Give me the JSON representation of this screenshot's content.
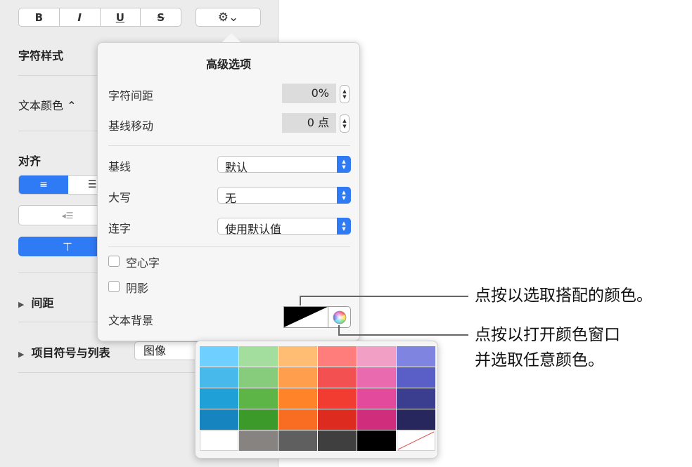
{
  "toolbar": {
    "bold_label": "B",
    "italic_label": "I",
    "underline_label": "U",
    "strike_label": "S",
    "gear_label": "⚙⌄"
  },
  "sidebar": {
    "char_style_label": "字符样式",
    "text_color_label": "文本颜色 ⌃",
    "align_label": "对齐",
    "spacing_label": "间距",
    "bullets_label": "项目符号与列表",
    "bullets_value": "图像",
    "align_left_icon": "≡",
    "align_center_icon": "☰",
    "indent_icon": "◂☰",
    "valign_top_icon": "⊤",
    "disclosure_icon": "▶"
  },
  "popover": {
    "title": "高级选项",
    "char_spacing_label": "字符间距",
    "char_spacing_value": "0%",
    "baseline_shift_label": "基线移动",
    "baseline_shift_value": "0 点",
    "baseline_label": "基线",
    "baseline_value": "默认",
    "caps_label": "大写",
    "caps_value": "无",
    "ligatures_label": "连字",
    "ligatures_value": "使用默认值",
    "outline_label": "空心字",
    "outline_checked": false,
    "shadow_label": "阴影",
    "shadow_checked": false,
    "text_bg_label": "文本背景",
    "stepper_icon_up": "▲",
    "stepper_icon_down": "▼"
  },
  "palette": {
    "colors": [
      "#6fcfff",
      "#a3de9f",
      "#ffbd73",
      "#ff7d7a",
      "#f19fc4",
      "#7e84e0",
      "#47b9ea",
      "#86cc7c",
      "#ff9f4d",
      "#f35151",
      "#ea6ab0",
      "#5a5ec7",
      "#1fa1d7",
      "#5db548",
      "#ff8328",
      "#f23c31",
      "#e34a9c",
      "#3b3e8f",
      "#1684be",
      "#3b9a2a",
      "#f86d22",
      "#dd2b20",
      "#d02d7d",
      "#27275e",
      "#ffffff",
      "#878380",
      "#5f5f5f",
      "#3f3f3f",
      "#000000",
      "none"
    ]
  },
  "callouts": {
    "preset_colors": "点按以选取搭配的颜色。",
    "color_window_line1": "点按以打开颜色窗口",
    "color_window_line2": "并选取任意颜色。"
  }
}
